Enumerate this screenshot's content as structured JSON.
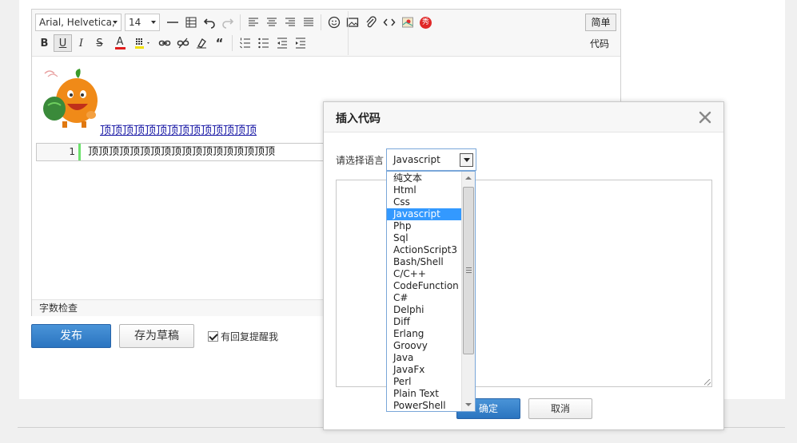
{
  "toolbar": {
    "font_family": "Arial, Helvetica,",
    "font_size": "14",
    "mode_simple": "简单",
    "mode_code": "代码",
    "row1_icons": [
      "horizontal-rule-icon",
      "table-icon",
      "undo-icon",
      "redo-icon",
      "align-left-icon",
      "align-center-icon",
      "align-right-icon",
      "align-justify-icon",
      "emoji-icon",
      "image-icon",
      "attachment-icon",
      "code-icon",
      "map-icon",
      "show-icon"
    ],
    "row2_icons": [
      "bold-icon",
      "underline-icon",
      "italic-icon",
      "strikethrough-icon",
      "font-color-icon",
      "background-color-icon",
      "link-icon",
      "unlink-icon",
      "clear-format-icon",
      "blockquote-icon",
      "ordered-list-icon",
      "unordered-list-icon",
      "outdent-icon",
      "indent-icon"
    ],
    "bold": "B",
    "underline": "U",
    "italic": "I",
    "strike": "S",
    "font_color": "A",
    "quote": "“",
    "show": "秀"
  },
  "editor": {
    "content_link": "顶顶顶顶顶顶顶顶顶顶顶顶顶顶",
    "code_line_number": "1",
    "code_line_text": "顶顶顶顶顶顶顶顶顶顶顶顶顶顶顶顶顶顶",
    "status_word_count": "字数检查"
  },
  "actions": {
    "publish": "发布",
    "save_draft": "存为草稿",
    "reply_remind": "有回复提醒我"
  },
  "dialog": {
    "title": "插入代码",
    "language_label": "请选择语言",
    "selected_language": "Javascript",
    "ok": "确定",
    "cancel": "取消",
    "languages": [
      "纯文本",
      "Html",
      "Css",
      "Javascript",
      "Php",
      "Sql",
      "ActionScript3",
      "Bash/Shell",
      "C/C++",
      "CodeFunction",
      "C#",
      "Delphi",
      "Diff",
      "Erlang",
      "Groovy",
      "Java",
      "JavaFx",
      "Perl",
      "Plain Text",
      "PowerShell"
    ]
  },
  "colors": {
    "accent": "#2a74c0",
    "selection": "#3399ff",
    "link": "#1a1aa6",
    "font_color_bar": "#e01b1b",
    "bg_color_bar": "#f0e000"
  }
}
